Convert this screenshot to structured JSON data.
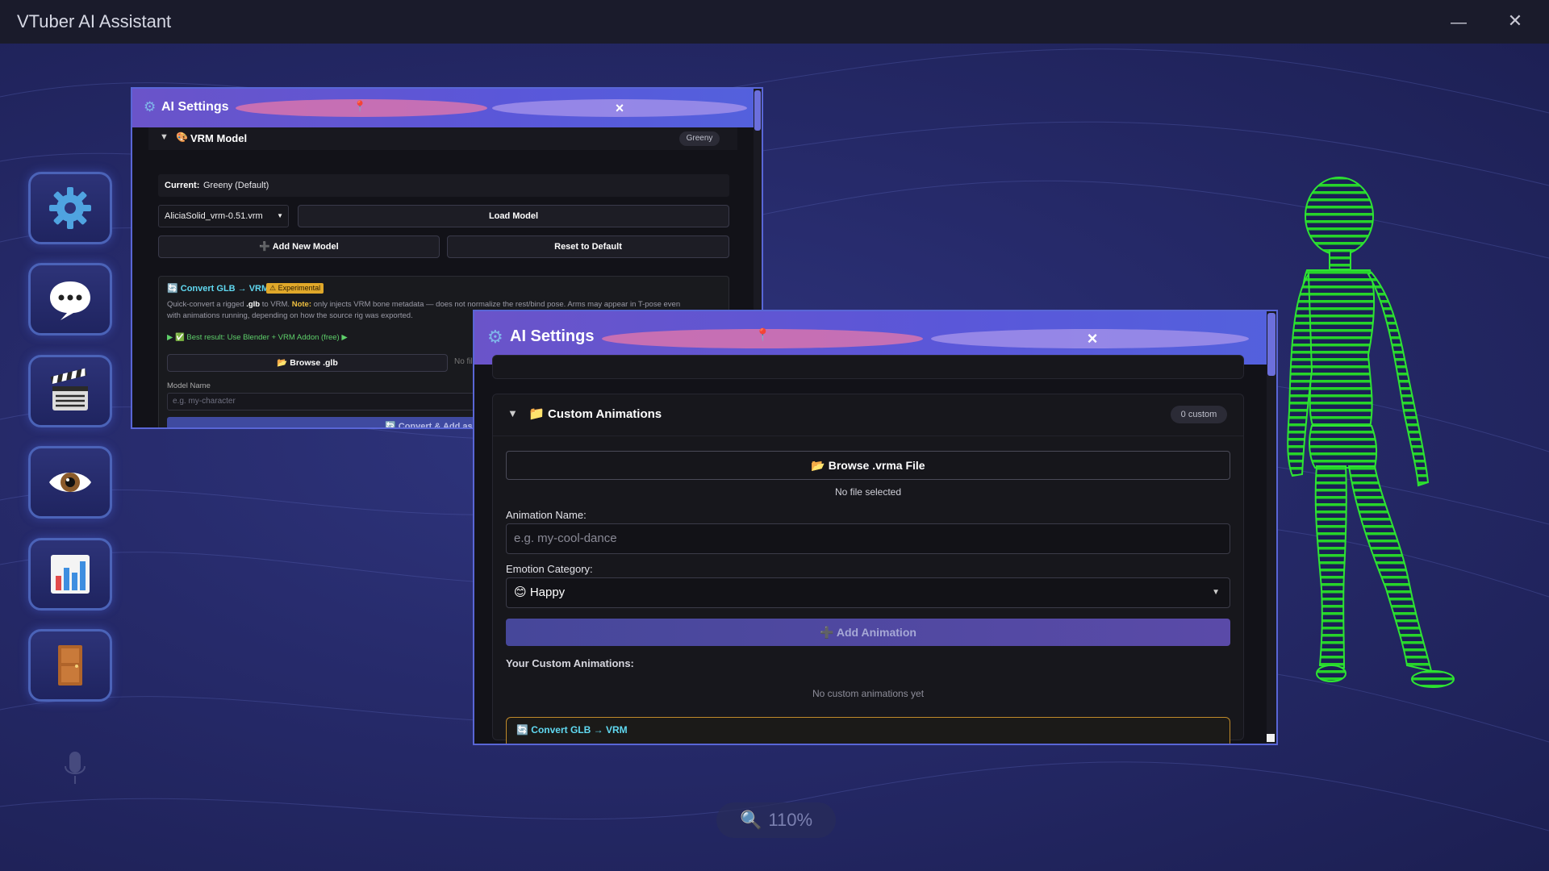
{
  "app": {
    "title": "VTuber AI Assistant",
    "minimize_icon": "minimize-icon",
    "close_icon": "close-icon"
  },
  "sidebar": {
    "items": [
      {
        "name": "settings",
        "icon": "gear-icon"
      },
      {
        "name": "chat",
        "icon": "speech-bubble-icon"
      },
      {
        "name": "animations",
        "icon": "clapperboard-icon"
      },
      {
        "name": "vision",
        "icon": "eye-icon"
      },
      {
        "name": "stats",
        "icon": "bar-chart-icon"
      },
      {
        "name": "exit",
        "icon": "door-icon"
      }
    ],
    "mic_icon": "microphone-icon"
  },
  "panel_back": {
    "title": "AI Settings",
    "close": "×",
    "section": {
      "arrow": "▼",
      "title": "VRM Model",
      "badge": "Greeny"
    },
    "current_label": "Current:",
    "current_value": "Greeny (Default)",
    "model_select": "AliciaSolid_vrm-0.51.vrm",
    "load_button": "Load Model",
    "add_button": "Add New Model",
    "reset_button": "Reset to Default",
    "convert": {
      "title": "Convert GLB → VRM",
      "tag": "Experimental",
      "desc_1": "Quick-convert a rigged ",
      "desc_glb": ".glb",
      "desc_2": " to VRM. ",
      "desc_note": "Note:",
      "desc_3": " only injects VRM bone metadata — does not normalize the rest/bind pose. Arms may appear in T-pose even with animations running, depending on how the source rig was exported.",
      "tip": "Best result: Use Blender + VRM Addon (free)",
      "browse": "Browse .glb",
      "no_file": "No file",
      "model_name_label": "Model Name",
      "model_name_placeholder": "e.g. my-character",
      "convert_button": "Convert & Add as"
    }
  },
  "panel_front": {
    "title": "AI Settings",
    "close": "×",
    "section": {
      "arrow": "▼",
      "title": "Custom Animations",
      "badge": "0 custom"
    },
    "browse_button": "Browse .vrma File",
    "no_file": "No file selected",
    "anim_name_label": "Animation Name:",
    "anim_name_placeholder": "e.g. my-cool-dance",
    "emotion_label": "Emotion Category:",
    "emotion_value": "Happy",
    "add_button": "Add Animation",
    "your_custom": "Your Custom Animations:",
    "empty": "No custom animations yet",
    "next_section_partial": "Convert GLB → VRM"
  },
  "zoom": {
    "value": "110%",
    "icon": "magnifier-icon"
  },
  "colors": {
    "accent": "#5a57d9",
    "header_pink": "#e878aa",
    "avatar_green": "#22d02a",
    "bg": "#262a6a"
  }
}
